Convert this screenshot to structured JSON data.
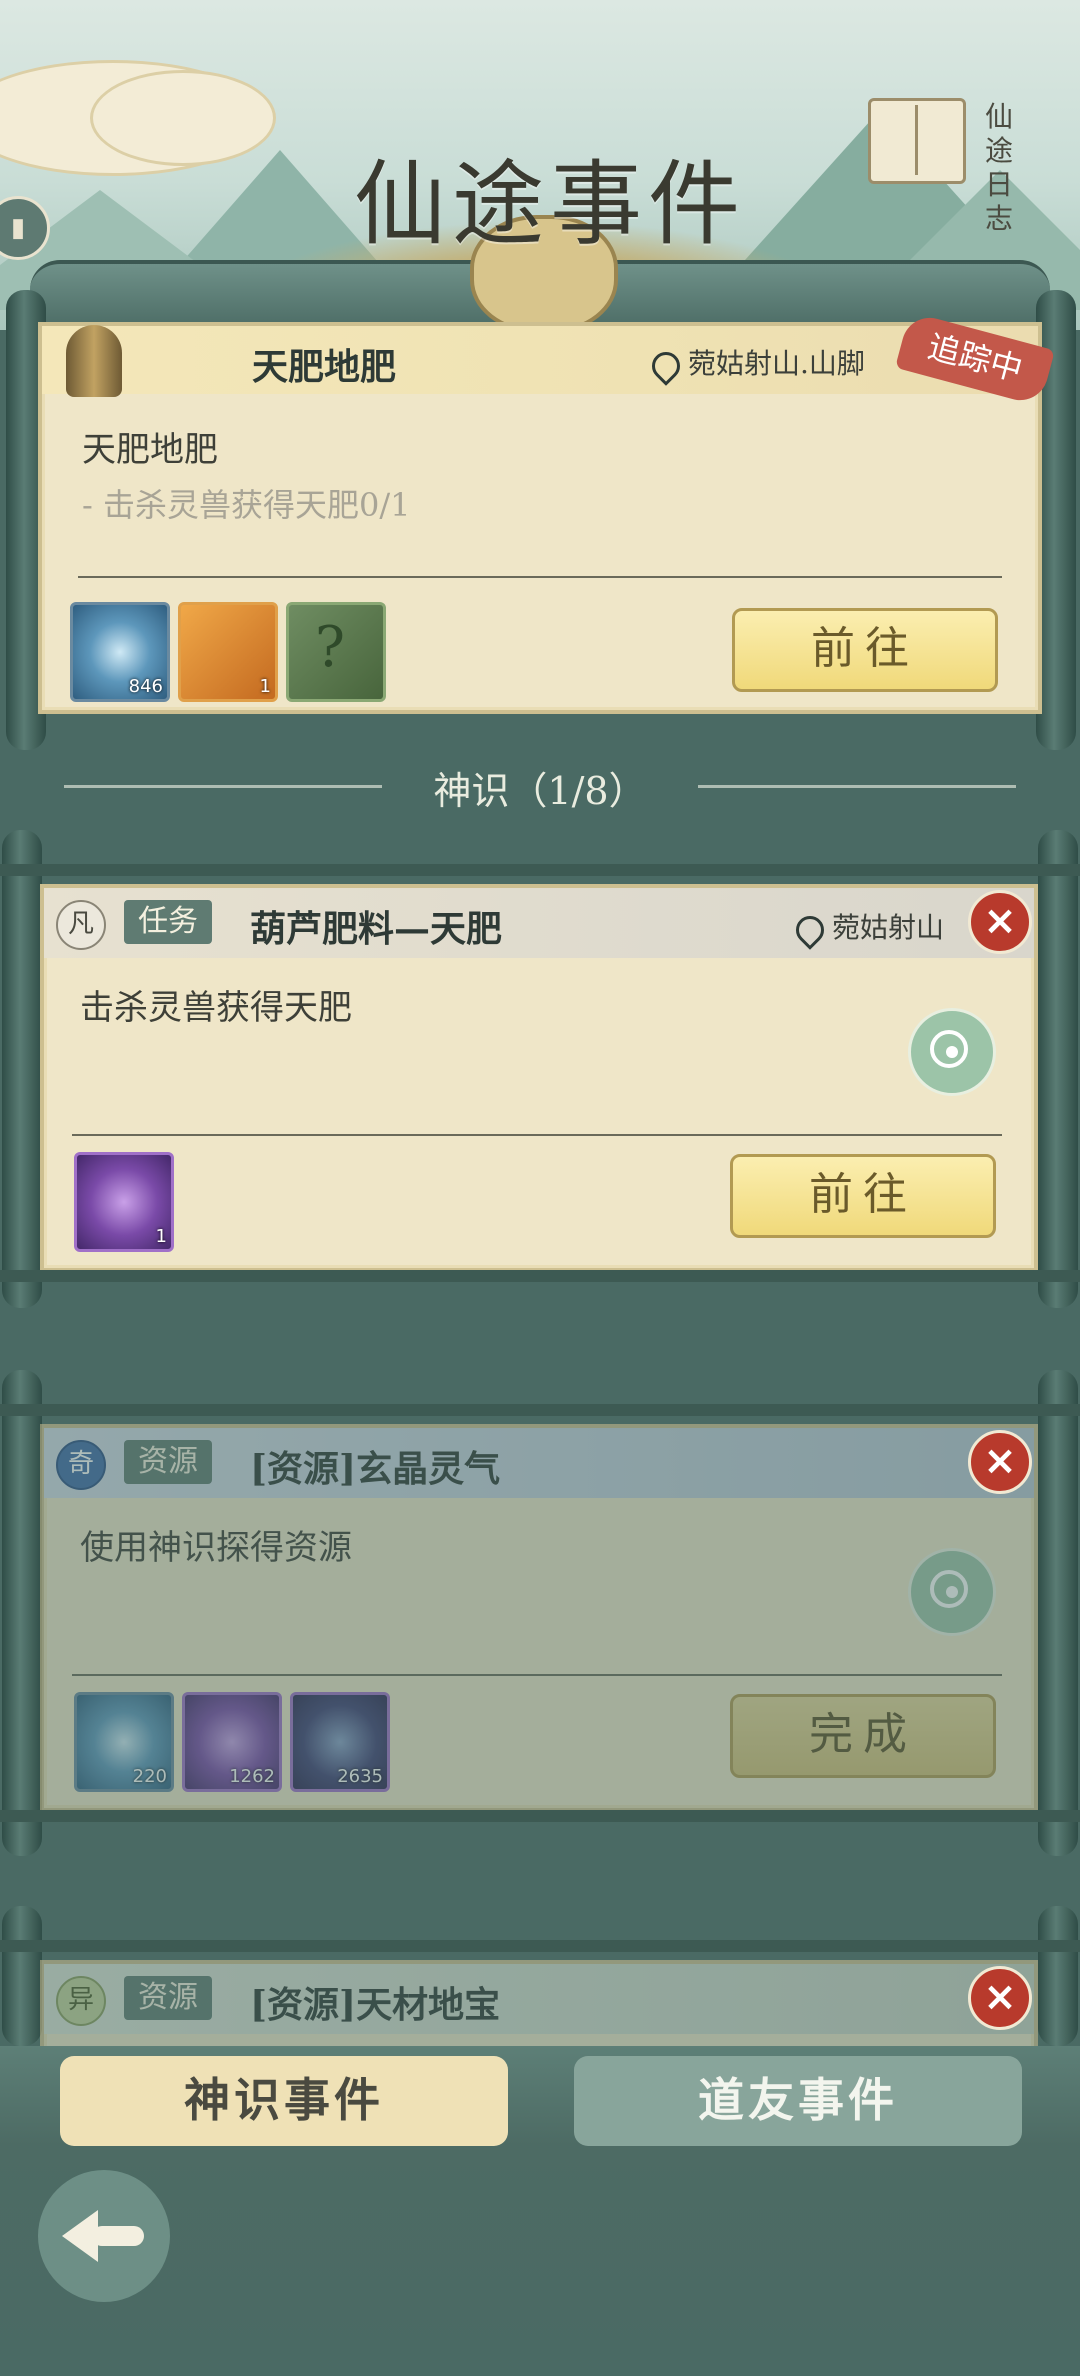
{
  "header": {
    "title": "仙途事件",
    "journal_label_1": "仙途",
    "journal_label_2": "日志"
  },
  "tracked_card": {
    "title": "天肥地肥",
    "location": "菀姑射山.山脚",
    "status_badge": "追踪中",
    "description": "天肥地肥",
    "objective": "- 击杀灵兽获得天肥0/1",
    "rewards": [
      {
        "icon": "spirit-swirl-icon",
        "count": "846"
      },
      {
        "icon": "spell-book-icon",
        "count": "1"
      },
      {
        "icon": "mystery-item-icon",
        "count": ""
      }
    ],
    "button": "前往"
  },
  "section": {
    "title": "神识（1/8）"
  },
  "events": [
    {
      "rank": "凡",
      "type": "任务",
      "title": "葫芦肥料—天肥",
      "location": "菀姑射山",
      "description": "击杀灵兽获得天肥",
      "rewards": [
        {
          "icon": "pink-orb-icon",
          "count": "1"
        }
      ],
      "button": "前往"
    },
    {
      "rank": "奇",
      "type": "资源",
      "title": "[资源]玄晶灵气",
      "description": "使用神识探得资源",
      "rewards": [
        {
          "icon": "spirit-swirl-icon",
          "count": "220"
        },
        {
          "icon": "purple-swirl-icon",
          "count": "1262"
        },
        {
          "icon": "crystal-ore-icon",
          "count": "2635"
        }
      ],
      "button": "完成"
    },
    {
      "rank": "异",
      "type": "资源",
      "title": "[资源]天材地宝"
    }
  ],
  "tabs": {
    "active": "神识事件",
    "inactive": "道友事件"
  },
  "colors": {
    "background": "#4a6a64",
    "parchment": "#efe6c8",
    "gold_button": "#f0d97a",
    "close_red": "#b83a2c",
    "tracking_badge": "#c3584a"
  }
}
